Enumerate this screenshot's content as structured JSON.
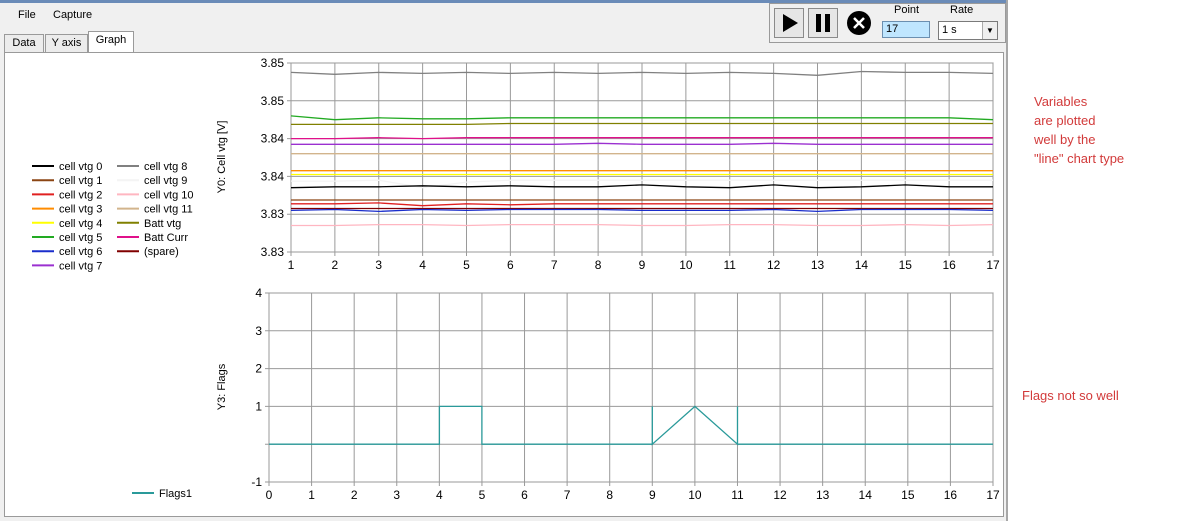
{
  "menu": [
    "File",
    "Capture"
  ],
  "tabs": [
    "Data",
    "Y axis",
    "Graph"
  ],
  "active_tab": "Graph",
  "toolbar": {
    "point_label": "Point",
    "point_value": "17",
    "rate_label": "Rate",
    "rate_value": "1 s",
    "buttons": [
      "play-icon",
      "pause-icon",
      "stop-icon"
    ]
  },
  "legend": [
    {
      "name": "cell vtg 0",
      "color": "#000000"
    },
    {
      "name": "cell vtg 1",
      "color": "#8b4513"
    },
    {
      "name": "cell vtg 2",
      "color": "#e02020"
    },
    {
      "name": "cell vtg 3",
      "color": "#ff8c00"
    },
    {
      "name": "cell vtg 4",
      "color": "#ffff00"
    },
    {
      "name": "cell vtg 5",
      "color": "#22aa22"
    },
    {
      "name": "cell vtg 6",
      "color": "#1a2ecc"
    },
    {
      "name": "cell vtg 7",
      "color": "#9b30d0"
    },
    {
      "name": "cell vtg 8",
      "color": "#808080"
    },
    {
      "name": "cell vtg 9",
      "color": "#f4f4f4"
    },
    {
      "name": "cell vtg 10",
      "color": "#ffb6c1"
    },
    {
      "name": "cell vtg 11",
      "color": "#d2b48c"
    },
    {
      "name": "Batt vtg",
      "color": "#808000"
    },
    {
      "name": "Batt Curr",
      "color": "#e0108a"
    },
    {
      "name": "(spare)",
      "color": "#800000"
    }
  ],
  "flags_legend": {
    "name": "Flags1",
    "color": "#2a9a9a"
  },
  "annotations": {
    "top": [
      "Variables",
      "are plotted",
      "well by the",
      "\"line\" chart type"
    ],
    "bottom": "Flags not so well"
  },
  "chart_data": [
    {
      "type": "line",
      "ylabel": "Y0: Cell vtg [V]",
      "xlim": [
        1,
        17
      ],
      "ylim": [
        3.83,
        3.85
      ],
      "y_tick_labels": [
        "3.83",
        "3.83",
        "3.84",
        "3.84",
        "3.85",
        "3.85"
      ],
      "x_tick_labels": [
        "1",
        "2",
        "3",
        "4",
        "5",
        "6",
        "7",
        "8",
        "9",
        "10",
        "11",
        "12",
        "13",
        "14",
        "15",
        "16",
        "17"
      ],
      "grid": true,
      "x": [
        1,
        2,
        3,
        4,
        5,
        6,
        7,
        8,
        9,
        10,
        11,
        12,
        13,
        14,
        15,
        16,
        17
      ],
      "series": [
        {
          "name": "cell vtg 8",
          "values": [
            3.849,
            3.8488,
            3.849,
            3.8489,
            3.849,
            3.8489,
            3.849,
            3.8489,
            3.849,
            3.8489,
            3.849,
            3.8489,
            3.8487,
            3.8491,
            3.849,
            3.849,
            3.8489
          ]
        },
        {
          "name": "cell vtg 5",
          "values": [
            3.8444,
            3.844,
            3.8442,
            3.8441,
            3.8441,
            3.8442,
            3.8442,
            3.8442,
            3.8442,
            3.8442,
            3.8442,
            3.8442,
            3.8442,
            3.8442,
            3.8442,
            3.8442,
            3.844
          ]
        },
        {
          "name": "Batt vtg",
          "values": [
            3.8435,
            3.8435,
            3.8435,
            3.8435,
            3.8435,
            3.8436,
            3.8436,
            3.8436,
            3.8436,
            3.8436,
            3.8436,
            3.8436,
            3.8436,
            3.8436,
            3.8436,
            3.8436,
            3.8436
          ]
        },
        {
          "name": "Batt Curr",
          "values": [
            3.842,
            3.842,
            3.8421,
            3.842,
            3.8421,
            3.8421,
            3.8421,
            3.8421,
            3.8421,
            3.8421,
            3.8421,
            3.8421,
            3.8421,
            3.8421,
            3.8421,
            3.8421,
            3.8421
          ]
        },
        {
          "name": "cell vtg 7",
          "values": [
            3.8414,
            3.8414,
            3.8414,
            3.8414,
            3.8414,
            3.8414,
            3.8414,
            3.8415,
            3.8414,
            3.8414,
            3.8414,
            3.8415,
            3.8414,
            3.8414,
            3.8414,
            3.8414,
            3.8414
          ]
        },
        {
          "name": "cell vtg 11",
          "values": [
            3.8404,
            3.8404,
            3.8404,
            3.8404,
            3.8404,
            3.8404,
            3.8404,
            3.8404,
            3.8404,
            3.8404,
            3.8404,
            3.8404,
            3.8404,
            3.8404,
            3.8404,
            3.8404,
            3.8404
          ]
        },
        {
          "name": "cell vtg 3",
          "values": [
            3.8386,
            3.8386,
            3.8386,
            3.8386,
            3.8386,
            3.8386,
            3.8386,
            3.8386,
            3.8386,
            3.8386,
            3.8386,
            3.8386,
            3.8386,
            3.8386,
            3.8386,
            3.8386,
            3.8386
          ]
        },
        {
          "name": "cell vtg 4",
          "values": [
            3.8382,
            3.8382,
            3.8382,
            3.8382,
            3.8382,
            3.8382,
            3.8382,
            3.8382,
            3.8382,
            3.8382,
            3.8382,
            3.8382,
            3.8382,
            3.8382,
            3.8382,
            3.8382,
            3.8382
          ]
        },
        {
          "name": "cell vtg 9",
          "values": [
            3.8375,
            3.8375,
            3.8376,
            3.8368,
            3.8374,
            3.8376,
            3.8376,
            3.8376,
            3.8376,
            3.8376,
            3.8376,
            3.8376,
            3.8376,
            3.8376,
            3.8376,
            3.8376,
            3.8376
          ]
        },
        {
          "name": "cell vtg 0",
          "values": [
            3.8368,
            3.8369,
            3.8369,
            3.837,
            3.8369,
            3.837,
            3.8369,
            3.8369,
            3.8371,
            3.8369,
            3.8368,
            3.8371,
            3.8368,
            3.8369,
            3.8371,
            3.8369,
            3.8369
          ]
        },
        {
          "name": "cell vtg 1",
          "values": [
            3.8355,
            3.8355,
            3.8355,
            3.8355,
            3.8355,
            3.8355,
            3.8355,
            3.8355,
            3.8355,
            3.8355,
            3.8355,
            3.8355,
            3.8355,
            3.8355,
            3.8355,
            3.8355,
            3.8355
          ]
        },
        {
          "name": "cell vtg 2",
          "values": [
            3.8351,
            3.8351,
            3.8352,
            3.8349,
            3.8351,
            3.835,
            3.8351,
            3.8351,
            3.8351,
            3.8351,
            3.8351,
            3.8351,
            3.8351,
            3.8351,
            3.8351,
            3.8351,
            3.8351
          ]
        },
        {
          "name": "(spare)",
          "values": [
            3.8346,
            3.8346,
            3.8346,
            3.8346,
            3.8346,
            3.8346,
            3.8346,
            3.8346,
            3.8346,
            3.8346,
            3.8346,
            3.8346,
            3.8346,
            3.8346,
            3.8346,
            3.8346,
            3.8346
          ]
        },
        {
          "name": "cell vtg 6",
          "values": [
            3.8344,
            3.8345,
            3.8343,
            3.8345,
            3.8344,
            3.8345,
            3.8345,
            3.8345,
            3.8344,
            3.8344,
            3.8344,
            3.8345,
            3.8343,
            3.8345,
            3.8345,
            3.8345,
            3.8344
          ]
        },
        {
          "name": "cell vtg 10",
          "values": [
            3.8328,
            3.8328,
            3.8329,
            3.8329,
            3.8328,
            3.8329,
            3.8329,
            3.8329,
            3.8328,
            3.8328,
            3.8329,
            3.8329,
            3.8328,
            3.8328,
            3.8329,
            3.8328,
            3.8329
          ]
        }
      ]
    },
    {
      "type": "line",
      "ylabel": "Y3: Flags",
      "xlim": [
        0,
        17
      ],
      "ylim": [
        -1,
        4
      ],
      "y_tick_labels": [
        "-1",
        "",
        "1",
        "2",
        "3",
        "4"
      ],
      "x_tick_labels": [
        "0",
        "1",
        "2",
        "3",
        "4",
        "5",
        "6",
        "7",
        "8",
        "9",
        "10",
        "11",
        "12",
        "13",
        "14",
        "15",
        "16",
        "17"
      ],
      "grid": true,
      "series": [
        {
          "name": "Flags1",
          "x": [
            0,
            4,
            4,
            5,
            5,
            9,
            9,
            9,
            10,
            11,
            11,
            11,
            12,
            17
          ],
          "values": [
            0,
            0,
            1,
            1,
            0,
            0,
            1,
            0,
            1,
            0,
            1,
            0,
            0,
            0
          ]
        }
      ]
    }
  ]
}
